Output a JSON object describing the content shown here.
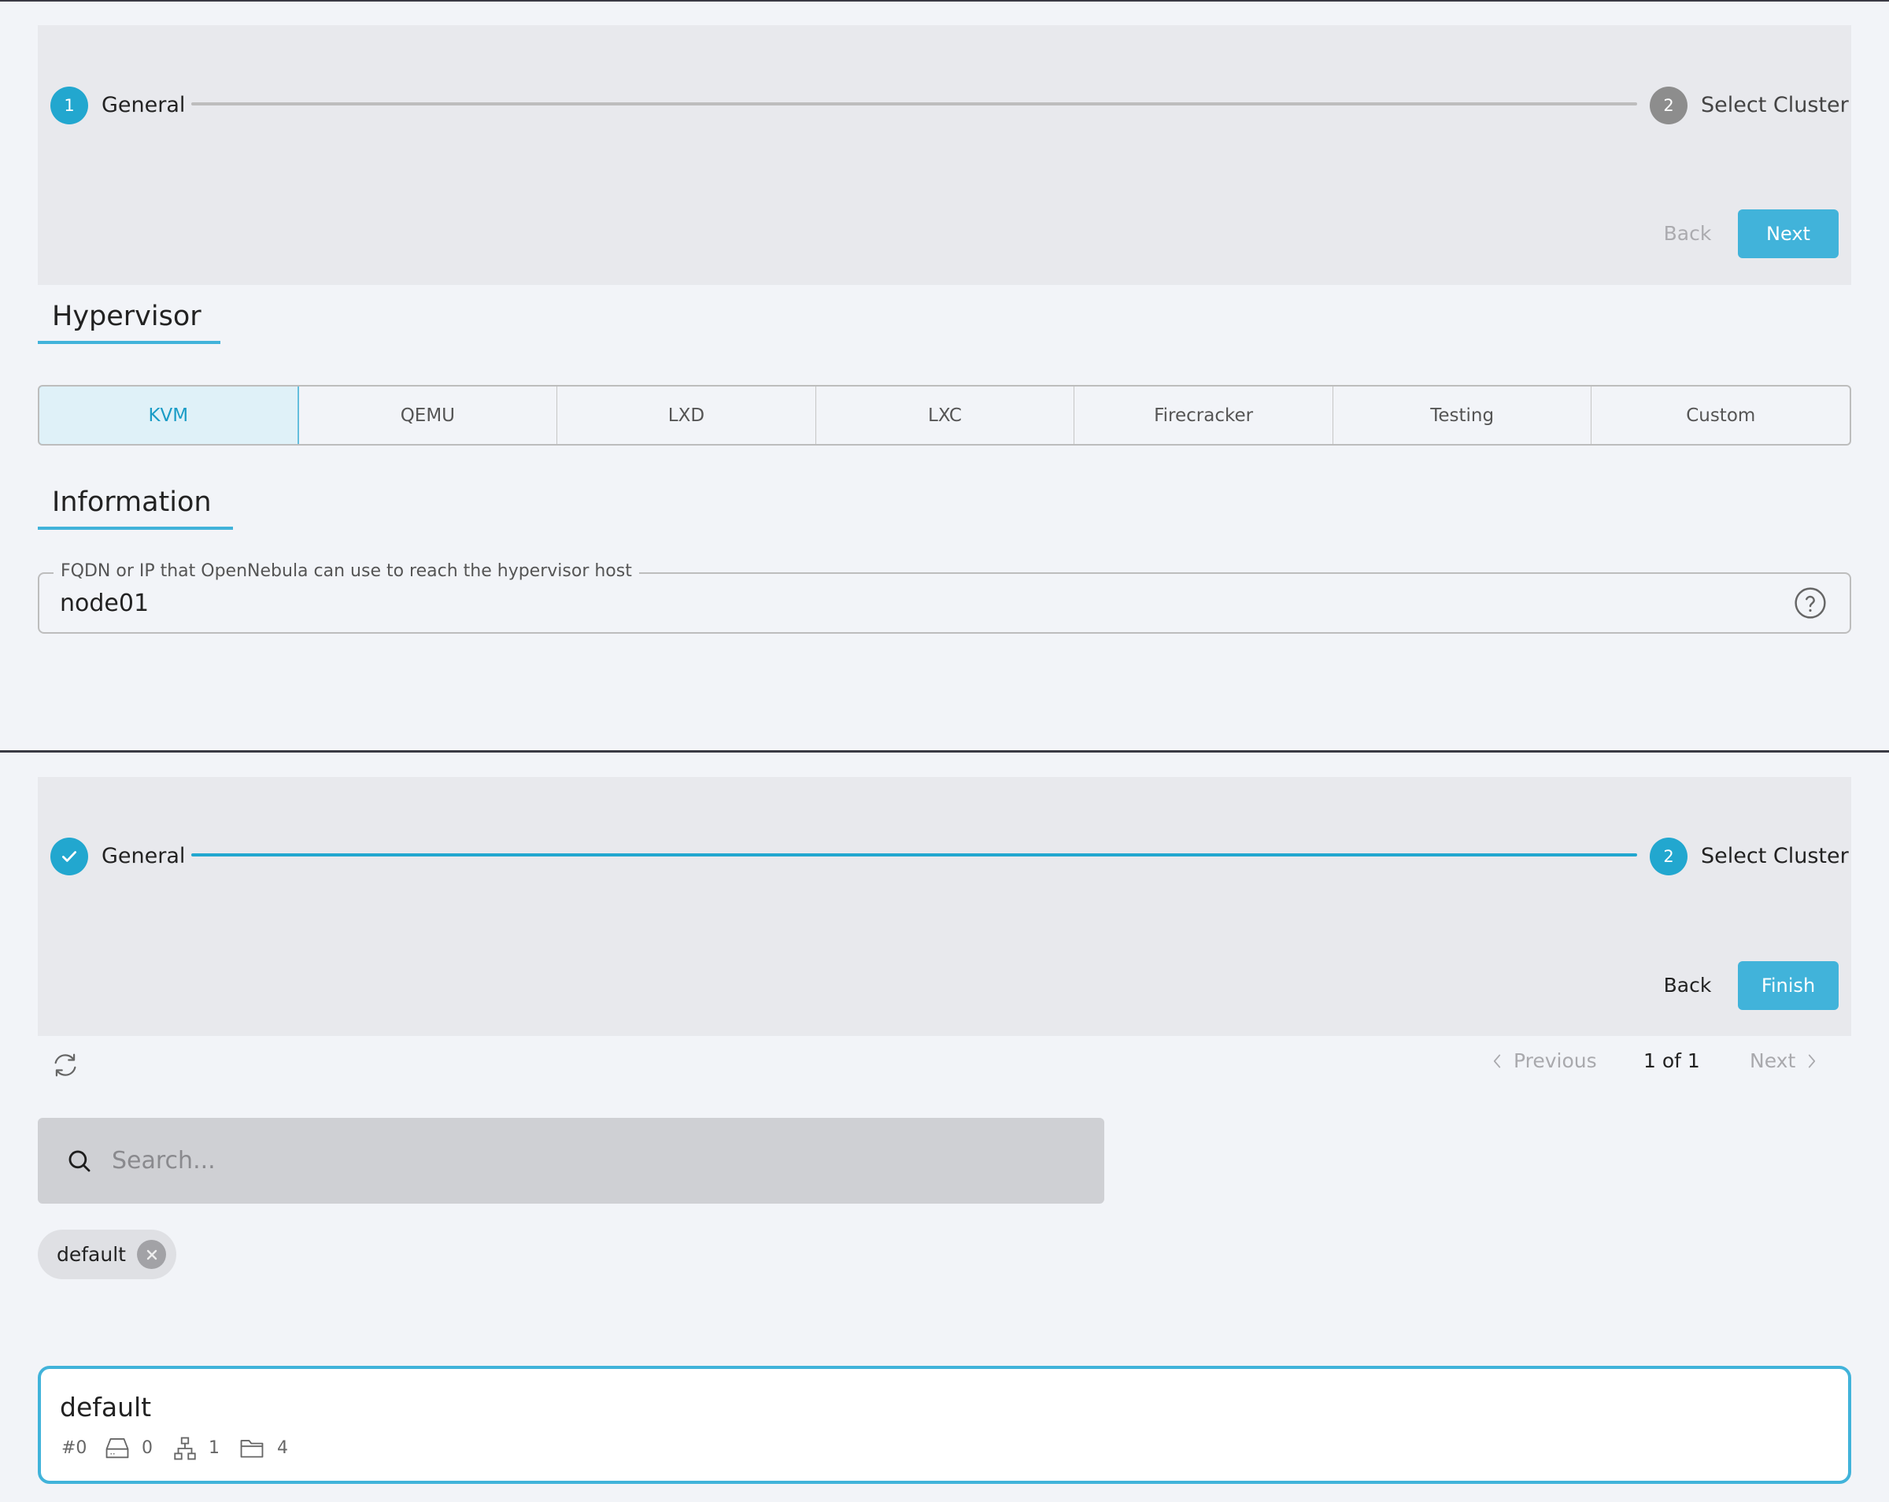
{
  "colors": {
    "accent": "#41b3da",
    "step_active": "#22a7cf",
    "step_inactive": "#8d8d8d"
  },
  "wizard_top": {
    "steps": [
      {
        "number": "1",
        "label": "General",
        "state": "active"
      },
      {
        "number": "2",
        "label": "Select Cluster",
        "state": "inactive"
      }
    ],
    "back_label": "Back",
    "back_enabled": false,
    "next_label": "Next"
  },
  "hypervisor": {
    "title": "Hypervisor",
    "options": [
      "KVM",
      "QEMU",
      "LXD",
      "LXC",
      "Firecracker",
      "Testing",
      "Custom"
    ],
    "selected": "KVM"
  },
  "information": {
    "title": "Information",
    "host_field": {
      "label": "FQDN or IP that OpenNebula can use to reach the hypervisor host",
      "value": "node01",
      "help_icon": "help-circle-icon"
    }
  },
  "wizard_bottom": {
    "steps": [
      {
        "number": "1",
        "label": "General",
        "state": "completed",
        "icon": "check-icon"
      },
      {
        "number": "2",
        "label": "Select Cluster",
        "state": "active"
      }
    ],
    "back_label": "Back",
    "back_enabled": true,
    "finish_label": "Finish"
  },
  "cluster_list": {
    "refresh_icon": "refresh-icon",
    "pagination": {
      "previous_label": "Previous",
      "page_text": "1 of 1",
      "next_label": "Next"
    },
    "search": {
      "placeholder": "Search...",
      "value": ""
    },
    "filter_chips": [
      {
        "label": "default"
      }
    ],
    "items": [
      {
        "name": "default",
        "id": "#0",
        "hosts": "0",
        "vnets": "1",
        "datastores": "4"
      }
    ]
  }
}
